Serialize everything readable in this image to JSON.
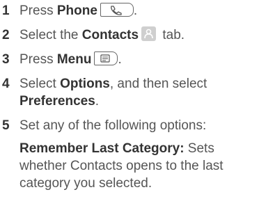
{
  "steps": [
    {
      "num": "1",
      "pre": "Press ",
      "bold": "Phone",
      "post": ".",
      "icon": "phone-key-icon"
    },
    {
      "num": "2",
      "pre": "Select the ",
      "bold": "Contacts",
      "post": " tab.",
      "icon": "contacts-tab-icon"
    },
    {
      "num": "3",
      "pre": "Press ",
      "bold": "Menu",
      "post": ".",
      "icon": "menu-key-icon"
    },
    {
      "num": "4",
      "pre": "Select ",
      "bold": "Options",
      "mid": ", and then select ",
      "bold2": "Preferences",
      "post": "."
    },
    {
      "num": "5",
      "text": "Set any of the following options:",
      "sub_bold": "Remember Last Category:",
      "sub_text": " Sets whether Contacts opens to the last category you selected."
    }
  ]
}
